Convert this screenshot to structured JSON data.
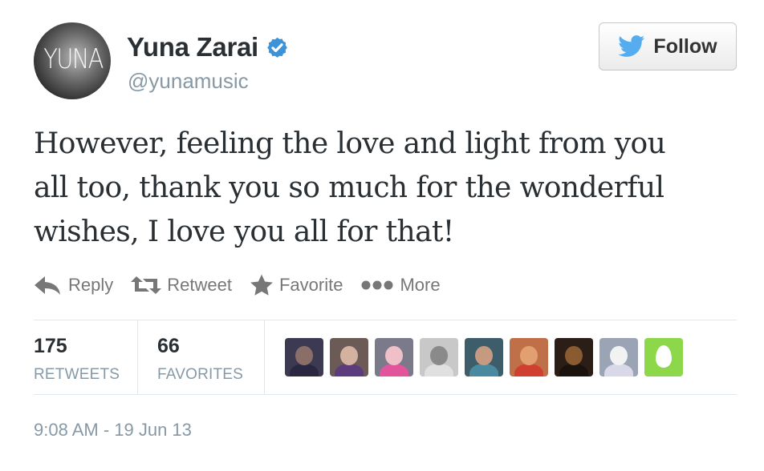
{
  "user": {
    "avatar_text": "YUNA",
    "display_name": "Yuna Zarai",
    "handle": "@yunamusic",
    "verified": true
  },
  "follow_button": {
    "label": "Follow",
    "icon": "twitter-bird-icon"
  },
  "tweet": {
    "lines": [
      "However, feeling the love and light from you",
      "all too, thank you so much for the wonderful",
      "wishes, I love you all for that!"
    ]
  },
  "actions": [
    {
      "label": "Reply",
      "icon": "reply-arrow-icon"
    },
    {
      "label": "Retweet",
      "icon": "retweet-icon"
    },
    {
      "label": "Favorite",
      "icon": "star-icon"
    },
    {
      "label": "More",
      "icon": "more-dots-icon"
    }
  ],
  "stats": {
    "retweets": {
      "count": "175",
      "label": "RETWEETS"
    },
    "favorites": {
      "count": "66",
      "label": "FAVORITES"
    }
  },
  "favoriters": [
    {
      "bg": "#3c3a52",
      "head": "#8a6f68",
      "body": "#2a2840"
    },
    {
      "bg": "#6b5a55",
      "head": "#d3b3a0",
      "body": "#5c3c7c"
    },
    {
      "bg": "#7a7a8a",
      "head": "#f0c0c8",
      "body": "#e2559c"
    },
    {
      "bg": "#c8c8c8",
      "head": "#8a8a8a",
      "body": "#e0e0e0"
    },
    {
      "bg": "#3e5d6a",
      "head": "#c69a80",
      "body": "#4a8aa0"
    },
    {
      "bg": "#c07048",
      "head": "#e2a070",
      "body": "#d04030"
    },
    {
      "bg": "#2a1e16",
      "head": "#8a5a30",
      "body": "#1a120c"
    },
    {
      "bg": "#9aa4b4",
      "head": "#f2f2f2",
      "body": "#d8d8e8"
    },
    {
      "bg": "egg"
    }
  ],
  "timestamp": "9:08 AM - 19 Jun 13",
  "colors": {
    "verified_blue": "#3b94d9",
    "twitter_blue": "#55acee",
    "muted_text": "#8899a6",
    "action_gray": "#777777"
  }
}
